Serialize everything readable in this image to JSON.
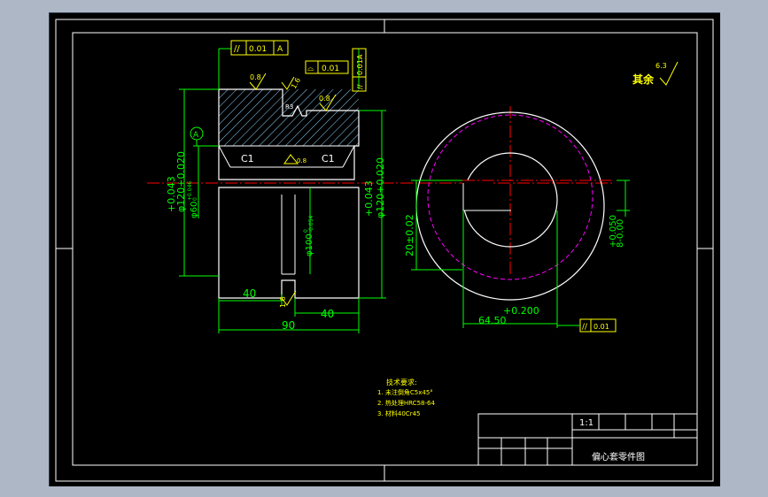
{
  "colors": {
    "workspace": "#adb7c6",
    "paper": "#000000",
    "frame": "#ffffff",
    "dimension": "#00ff00",
    "centerline": "#ff0000",
    "hidden": "#ff00ff",
    "hatch": "#8fd3ff",
    "symbol": "#ffff00"
  },
  "tolerance_frames": {
    "top_parallel": {
      "symbol": "//",
      "value": "0.01",
      "datum": "A"
    },
    "upper_frame": {
      "symbol": "⌓",
      "value": "0.01"
    },
    "vertical_frame": {
      "symbol": "//",
      "value": "0.01",
      "datum": "A"
    },
    "right_parallel": {
      "symbol": "//",
      "value": "0.01"
    }
  },
  "roughness": {
    "general": "6.3",
    "general_label": "其余",
    "top_left": "0.8",
    "top_right": "0.8",
    "slot": "1.6",
    "bore": "0.8",
    "bottom": "1.6"
  },
  "section_labels": {
    "chamfer_left": "C1",
    "chamfer_right": "C1",
    "undercut": "R3",
    "datum": "A"
  },
  "dimensions": {
    "outer_dia_left": "+0.043\nφ120+0.020",
    "outer_tol_upper": "+0.043",
    "outer_nominal": "φ120+0.020",
    "bore_left_nominal": "φ60",
    "bore_left_tol": "+0.046\n0",
    "bore_tol_upper": "+0.046",
    "bore_tol_lower": "0",
    "outer_right_tol": "+0.043",
    "outer_right_nominal": "φ120+0.020",
    "hub_nominal": "φ100",
    "hub_tol": "0\n-0.054",
    "hub_tol_upper": "0",
    "hub_tol_lower": "-0.054",
    "length_left": "40",
    "length_right": "40",
    "length_total": "90",
    "offset": "20±0.02",
    "keyway_width": "64.50",
    "keyway_tol": "+0.200",
    "key_vertical": "8-0.00",
    "key_vertical_tol": "+0.050"
  },
  "technical_requirements": {
    "title": "技术要求:",
    "items": [
      "1. 未注倒角C5x45°",
      "2. 热处理HRC58-64",
      "3. 材料40Cr45"
    ]
  },
  "title_block": {
    "scale": "1:1",
    "name": "偏心套零件图"
  }
}
